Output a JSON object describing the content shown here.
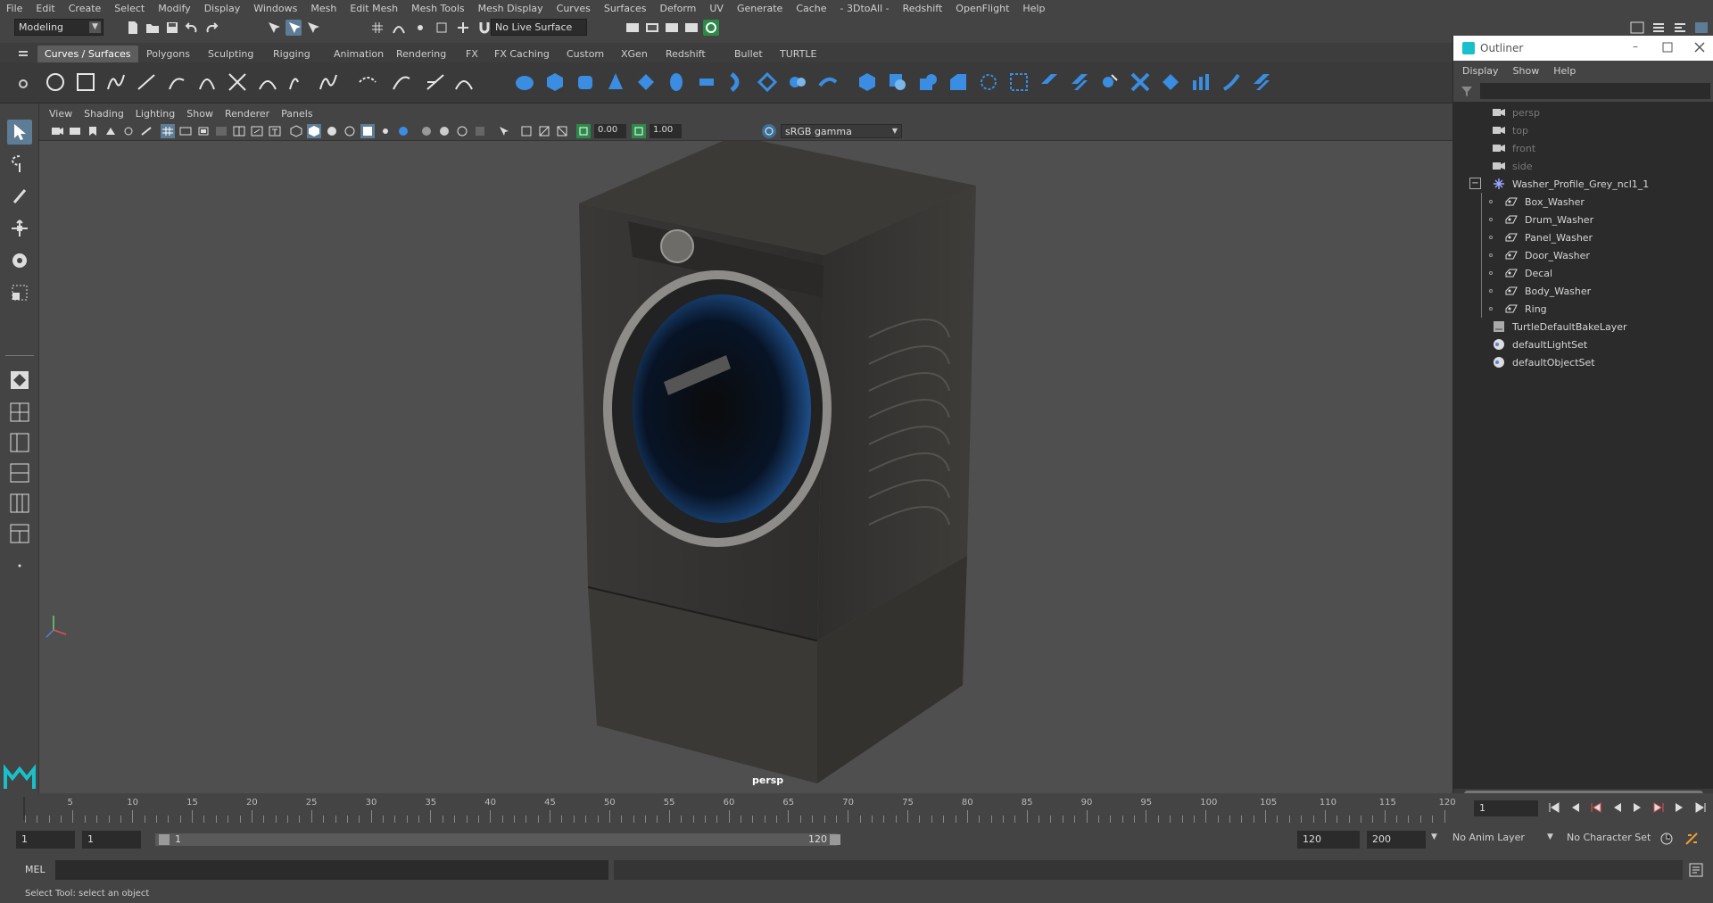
{
  "menubar": {
    "items": [
      "File",
      "Edit",
      "Create",
      "Select",
      "Modify",
      "Display",
      "Windows",
      "Mesh",
      "Edit Mesh",
      "Mesh Tools",
      "Mesh Display",
      "Curves",
      "Surfaces",
      "Deform",
      "UV",
      "Generate",
      "Cache",
      "- 3DtoAll -",
      "Redshift",
      "OpenFlight",
      "Help"
    ]
  },
  "statusline": {
    "mode": "Modeling",
    "live_surface": "No Live Surface"
  },
  "shelf": {
    "tabs": [
      "Curves / Surfaces",
      "Polygons",
      "Sculpting",
      "Rigging",
      "Animation",
      "Rendering",
      "FX",
      "FX Caching",
      "Custom",
      "XGen",
      "Redshift",
      "Bullet",
      "TURTLE"
    ],
    "active_tab": 0
  },
  "panel": {
    "menu": [
      "View",
      "Shading",
      "Lighting",
      "Show",
      "Renderer",
      "Panels"
    ],
    "exposure": "0.00",
    "gamma": "1.00",
    "colorspace": "sRGB gamma",
    "camera_label": "persp"
  },
  "outliner": {
    "title": "Outliner",
    "menu": [
      "Display",
      "Show",
      "Help"
    ],
    "items": [
      {
        "label": "persp",
        "depth": 0,
        "dim": true,
        "icon": "camera-icon"
      },
      {
        "label": "top",
        "depth": 0,
        "dim": true,
        "icon": "camera-icon"
      },
      {
        "label": "front",
        "depth": 0,
        "dim": true,
        "icon": "camera-icon"
      },
      {
        "label": "side",
        "depth": 0,
        "dim": true,
        "icon": "camera-icon"
      },
      {
        "label": "Washer_Profile_Grey_ncl1_1",
        "depth": 0,
        "dim": false,
        "icon": "group-icon"
      },
      {
        "label": "Box_Washer",
        "depth": 1,
        "dim": false,
        "icon": "mesh-icon"
      },
      {
        "label": "Drum_Washer",
        "depth": 1,
        "dim": false,
        "icon": "mesh-icon"
      },
      {
        "label": "Panel_Washer",
        "depth": 1,
        "dim": false,
        "icon": "mesh-icon"
      },
      {
        "label": "Door_Washer",
        "depth": 1,
        "dim": false,
        "icon": "mesh-icon"
      },
      {
        "label": "Decal",
        "depth": 1,
        "dim": false,
        "icon": "mesh-icon"
      },
      {
        "label": "Body_Washer",
        "depth": 1,
        "dim": false,
        "icon": "mesh-icon"
      },
      {
        "label": "Ring",
        "depth": 1,
        "dim": false,
        "icon": "mesh-icon"
      },
      {
        "label": "TurtleDefaultBakeLayer",
        "depth": 0,
        "dim": false,
        "icon": "bake-layer-icon"
      },
      {
        "label": "defaultLightSet",
        "depth": 0,
        "dim": false,
        "icon": "set-icon"
      },
      {
        "label": "defaultObjectSet",
        "depth": 0,
        "dim": false,
        "icon": "set-icon"
      }
    ]
  },
  "timeslider": {
    "ticks": [
      "5",
      "10",
      "15",
      "20",
      "25",
      "30",
      "35",
      "40",
      "45",
      "50",
      "55",
      "60",
      "65",
      "70",
      "75",
      "80",
      "85",
      "90",
      "95",
      "100",
      "105",
      "110",
      "115",
      "120"
    ],
    "current_frame_marker": "1",
    "current_frame_field": "1"
  },
  "rangebar": {
    "start_field": "1",
    "start_field2": "1",
    "range_start": "1",
    "range_end": "120",
    "end_field": "120",
    "end_field2": "200",
    "anim_layer": "No Anim Layer",
    "character_set": "No Character Set"
  },
  "cmdline": {
    "label": "MEL"
  },
  "helpline": {
    "text": "Select Tool: select an object"
  },
  "colors": {
    "accent": "#5d7c95",
    "maya_teal": "#19c0c9"
  }
}
